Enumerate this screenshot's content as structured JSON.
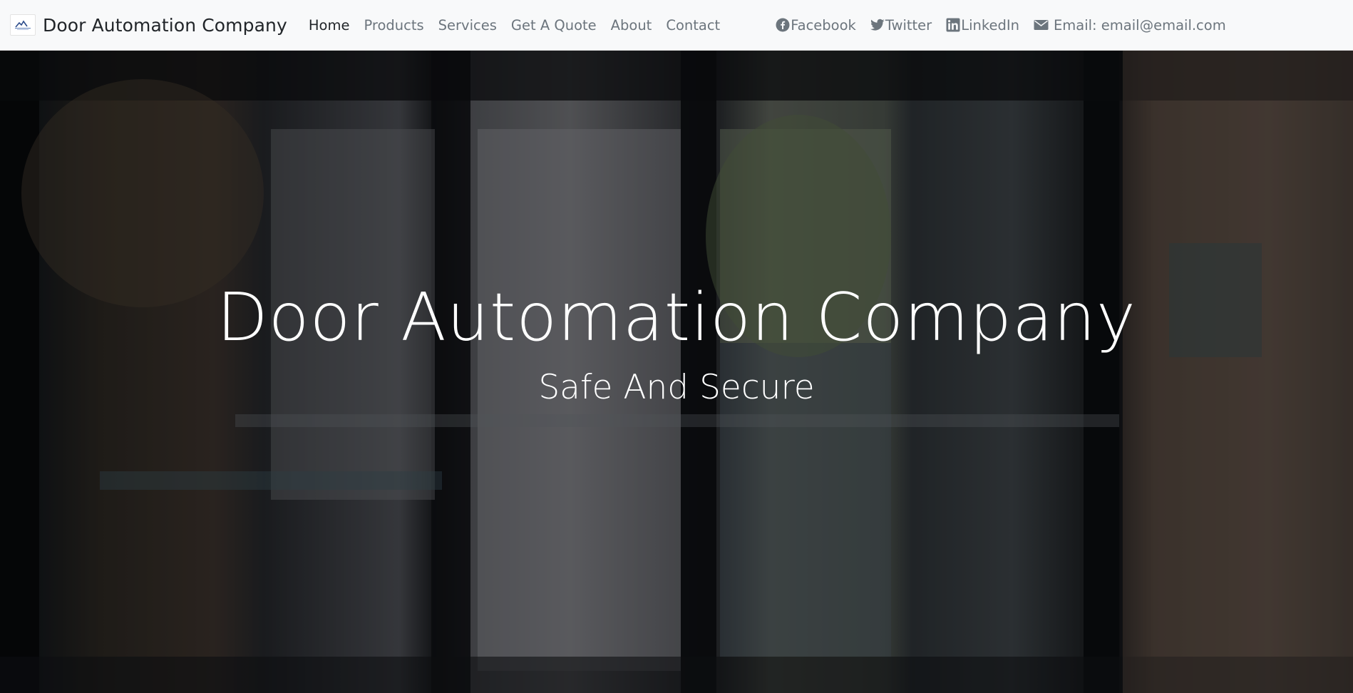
{
  "brand": {
    "name": "Door Automation Company"
  },
  "nav": {
    "items": [
      {
        "label": "Home",
        "active": true
      },
      {
        "label": "Products",
        "active": false
      },
      {
        "label": "Services",
        "active": false
      },
      {
        "label": "Get A Quote",
        "active": false
      },
      {
        "label": "About",
        "active": false
      },
      {
        "label": "Contact",
        "active": false
      }
    ]
  },
  "social": {
    "facebook": {
      "label": "Facebook",
      "icon": "facebook-icon"
    },
    "twitter": {
      "label": "Twitter",
      "icon": "twitter-icon"
    },
    "linkedin": {
      "label": "LinkedIn",
      "icon": "linkedin-icon"
    },
    "email": {
      "label": "Email: email@email.com",
      "icon": "envelope-icon"
    }
  },
  "hero": {
    "title": "Door Automation Company",
    "subtitle": "Safe And Secure"
  },
  "colors": {
    "navbar_bg": "#f8f9fa",
    "nav_link": "#6c757d",
    "nav_link_active": "#212529",
    "hero_text": "#ffffff"
  }
}
